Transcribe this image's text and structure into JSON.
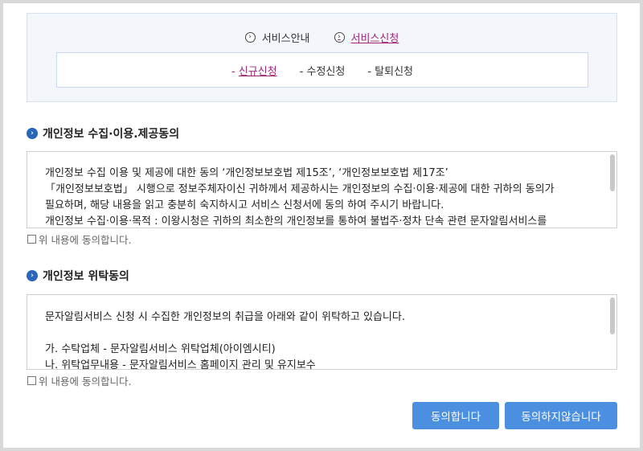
{
  "nav": {
    "service_info": "서비스안내",
    "service_apply": "서비스신청"
  },
  "subnav": {
    "new_prefix": "- ",
    "new": "신규신청",
    "edit": "- 수정신청",
    "withdraw": "- 탈퇴신청"
  },
  "section1": {
    "title": "개인정보 수집·이용.제공동의",
    "lines": [
      "개인정보 수집 이용 및 제공에 대한 동의 ‘개인정보보호법 제15조’, ‘개인정보보호법 제17조’",
      "「개인정보보호법」 시행으로 정보주체자이신 귀하께서 제공하시는 개인정보의 수집·이용·제공에 대한 귀하의 동의가",
      "필요하며, 해당 내용을 읽고 충분히 숙지하시고 서비스 신청서에 동의 하여 주시기 바랍니다.",
      "개인정보 수집·이용·목적 : 이왕시청은 귀하의 최소한의 개인정보를 통하여 불법주·정차 단속 관련 문자알림서비스를"
    ],
    "agree_label": "위 내용에 동의합니다."
  },
  "section2": {
    "title": "개인정보 위탁동의",
    "lines": [
      "문자알림서비스 신청 시 수집한 개인정보의 취급을 아래와 같이 위탁하고 있습니다.",
      "",
      "가. 수탁업체 - 문자알림서비스 위탁업체(아이엠시티)",
      "나. 위탁업무내용 - 문자알림서비스 홈페이지 관리 및 유지보수"
    ],
    "agree_label": "위 내용에 동의합니다."
  },
  "buttons": {
    "agree": "동의합니다",
    "disagree": "동의하지않습니다"
  }
}
